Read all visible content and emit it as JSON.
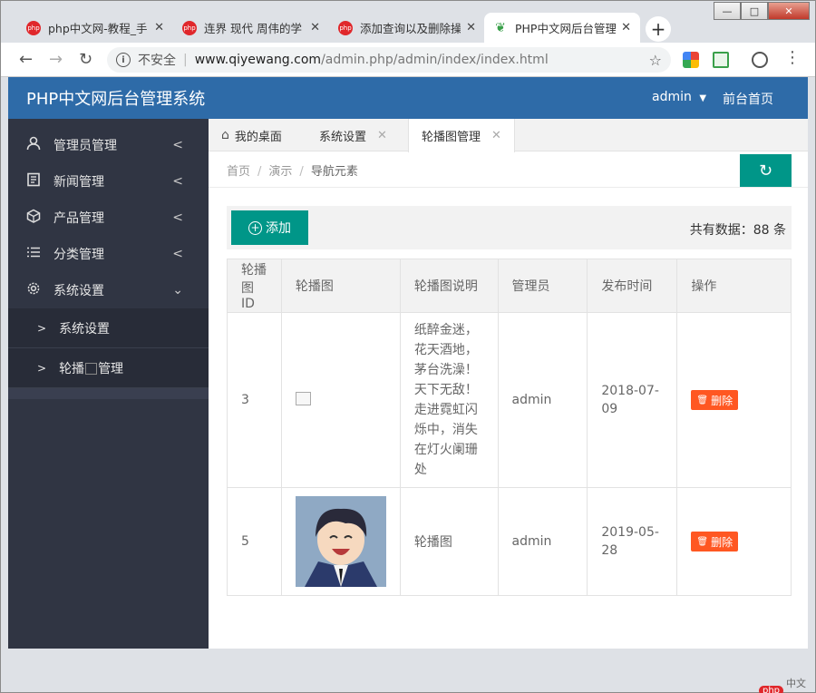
{
  "browser": {
    "tabs": [
      {
        "title": "php中文网-教程_手"
      },
      {
        "title": "连界 现代 周伟的学"
      },
      {
        "title": "添加查询以及删除操"
      },
      {
        "title": "PHP中文网后台管理"
      }
    ],
    "new_tab": "+",
    "address": {
      "security": "不安全",
      "separator": "|",
      "host": "www.qiyewang.com",
      "path": "/admin.php/admin/index/index.html"
    },
    "window_controls": {
      "minimize": "—",
      "maximize": "□",
      "close": "✕"
    }
  },
  "header": {
    "brand": "PHP中文网后台管理系统",
    "user": "admin",
    "frontpage": "前台首页"
  },
  "sidebar": {
    "items": [
      {
        "label": "管理员管理",
        "icon": "user-icon"
      },
      {
        "label": "新闻管理",
        "icon": "document-icon"
      },
      {
        "label": "产品管理",
        "icon": "box-icon"
      },
      {
        "label": "分类管理",
        "icon": "list-icon"
      },
      {
        "label": "系统设置",
        "icon": "gear-icon"
      }
    ],
    "submenu": [
      {
        "label": "系统设置"
      },
      {
        "label_prefix": "轮播",
        "label_suffix": "管理"
      }
    ]
  },
  "content_tabs": [
    {
      "label": "我的桌面"
    },
    {
      "label": "系统设置"
    },
    {
      "label": "轮播图管理"
    }
  ],
  "breadcrumb": {
    "home": "首页",
    "demo": "演示",
    "current": "导航元素",
    "sep": "/"
  },
  "actions": {
    "add": "添加",
    "total": "共有数据：88 条"
  },
  "table": {
    "headers": [
      "轮播图ID",
      "轮播图",
      "轮播图说明",
      "管理员",
      "发布时间",
      "操作"
    ],
    "rows": [
      {
        "id": "3",
        "description": "纸醉金迷，花天酒地，茅台洗澡！天下无敌！走进霓虹闪烁中，消失在灯火阑珊处",
        "admin": "admin",
        "time": "2018-07-09",
        "delete": "删除"
      },
      {
        "id": "5",
        "description": "轮播图",
        "admin": "admin",
        "time": "2019-05-28",
        "delete": "删除"
      }
    ]
  },
  "watermark": {
    "logo": "php",
    "text": "中文网"
  },
  "colors": {
    "header": "#2e6ba8",
    "sidebar": "#303543",
    "primary": "#009688",
    "danger": "#ff5722"
  }
}
